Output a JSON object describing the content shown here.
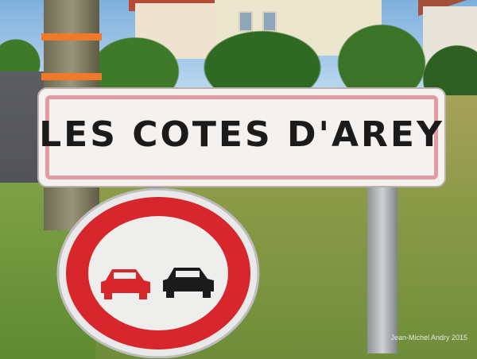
{
  "sign": {
    "text": "LES COTES D'AREY"
  },
  "photo_credit": "Jean-Michel Andry 2015",
  "colors": {
    "sign_border": "#e39aa2",
    "sign_bg": "#f4f1ee",
    "round_red": "#d8262d",
    "tape": "#f07a2a"
  }
}
